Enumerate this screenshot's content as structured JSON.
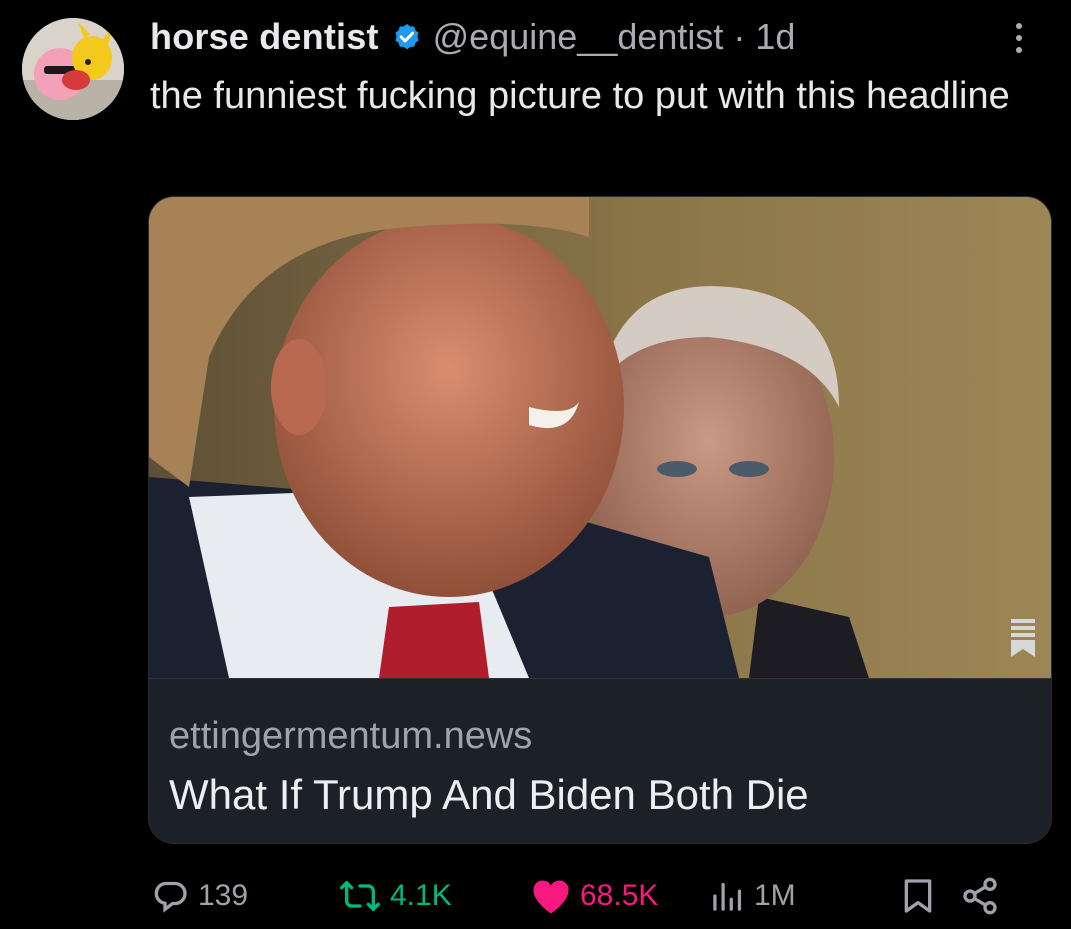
{
  "tweet": {
    "display_name": "horse dentist",
    "handle": "@equine__dentist",
    "separator": "·",
    "time": "1d",
    "text": "the funniest fucking picture to put with this headline",
    "verified": true
  },
  "card": {
    "domain": "ettingermentum.news",
    "headline": "What If Trump And Biden Both Die"
  },
  "actions": {
    "replies": "139",
    "reposts": "4.1K",
    "likes": "68.5K",
    "views": "1M"
  },
  "icons": [
    "verified-badge-icon",
    "more-icon",
    "reply-icon",
    "repost-icon",
    "like-icon",
    "views-icon",
    "bookmark-icon",
    "share-icon",
    "reader-icon"
  ],
  "colors": {
    "background": "#000000",
    "text": "#e7e9ea",
    "muted": "#a9acb0",
    "verified": "#1d9bf0",
    "repost": "#00ba7c",
    "like": "#f91880"
  }
}
